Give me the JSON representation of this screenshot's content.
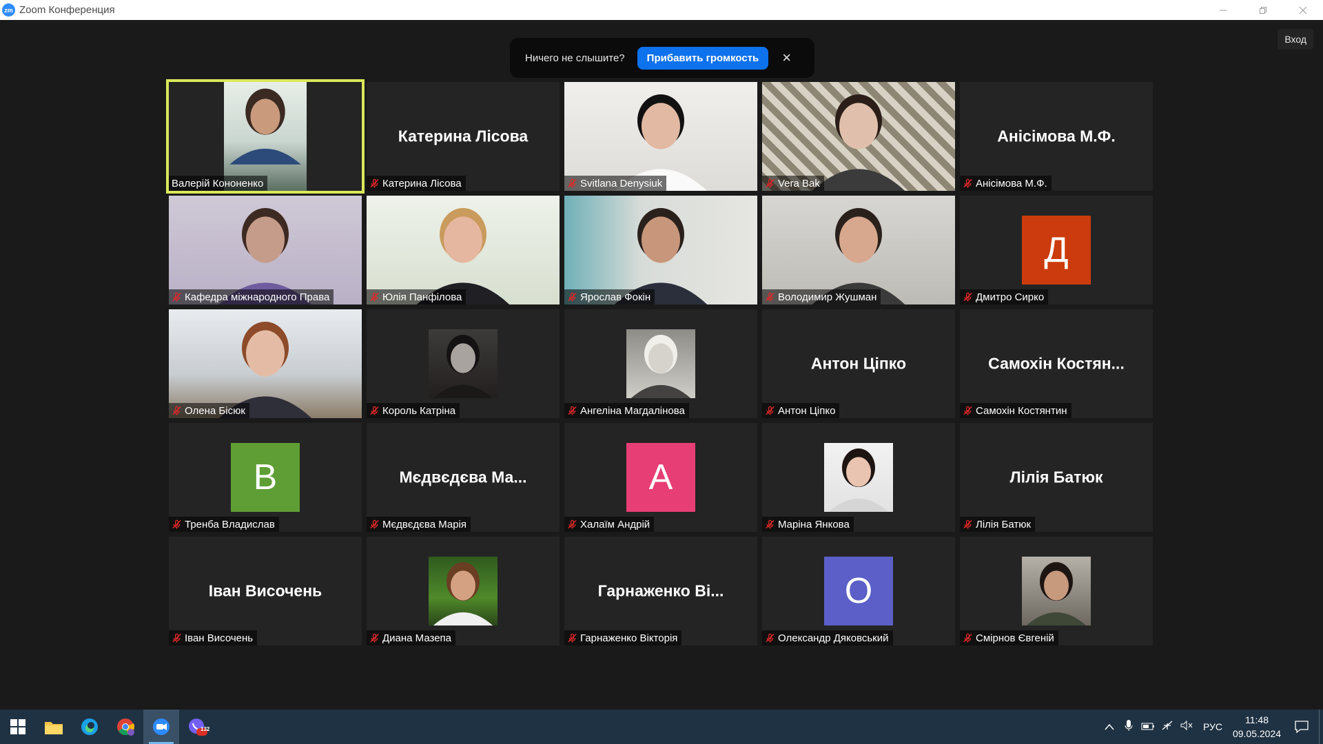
{
  "window": {
    "title": "Zoom Конференция",
    "logo": "zm",
    "sign_in": "Вход"
  },
  "banner": {
    "text": "Ничего не слышите?",
    "button": "Прибавить громкость",
    "close": "×"
  },
  "participants": [
    {
      "name": "Валерій Кононенко",
      "kind": "photo",
      "active": true,
      "muted": false,
      "scene": "man-office"
    },
    {
      "name": "Катерина Лісова",
      "kind": "name",
      "center": "Катерина Лісова",
      "muted": true
    },
    {
      "name": "Svitlana Denysiuk",
      "kind": "photo",
      "muted": true,
      "scene": "woman-dark"
    },
    {
      "name": "Vera Bak",
      "kind": "photo",
      "muted": true,
      "scene": "woman-pattern"
    },
    {
      "name": "Анісімова М.Ф.",
      "kind": "name",
      "center": "Анісімова М.Ф.",
      "muted": true
    },
    {
      "name": "Кафедра міжнародного Права",
      "kind": "photo",
      "muted": true,
      "scene": "woman-glasses"
    },
    {
      "name": "Юлія Панфілова",
      "kind": "photo",
      "muted": true,
      "scene": "woman-blonde"
    },
    {
      "name": "Ярослав Фокін",
      "kind": "photo",
      "muted": true,
      "scene": "man-suit"
    },
    {
      "name": "Володимир Жушман",
      "kind": "photo",
      "muted": true,
      "scene": "man-wall"
    },
    {
      "name": "Дмитро Сирко",
      "kind": "avatar",
      "letter": "Д",
      "color": "#cc3b0d",
      "muted": true
    },
    {
      "name": "Олена Бісюк",
      "kind": "photo",
      "muted": true,
      "scene": "woman-office"
    },
    {
      "name": "Король Катріна",
      "kind": "small-photo",
      "muted": true,
      "scene": "bw-woman-dark"
    },
    {
      "name": "Ангеліна Магдалінова",
      "kind": "small-photo",
      "muted": true,
      "scene": "bw-woman-light"
    },
    {
      "name": "Антон Ціпко",
      "kind": "name",
      "center": "Антон Ціпко",
      "muted": true
    },
    {
      "name": "Самохін Костянтин",
      "kind": "name",
      "center": "Самохін Костян...",
      "muted": true
    },
    {
      "name": "Тренба Владислав",
      "kind": "avatar",
      "letter": "В",
      "color": "#5f9e34",
      "muted": true
    },
    {
      "name": "Мєдвєдєва Марія",
      "kind": "name",
      "center": "Мєдвєдєва Ма...",
      "muted": true
    },
    {
      "name": "Халаїм Андрій",
      "kind": "avatar",
      "letter": "А",
      "color": "#e83e76",
      "muted": true
    },
    {
      "name": "Маріна Янкова",
      "kind": "small-photo",
      "muted": true,
      "scene": "woman-portrait"
    },
    {
      "name": "Лілія Батюк",
      "kind": "name",
      "center": "Лілія Батюк",
      "muted": true
    },
    {
      "name": "Іван Височень",
      "kind": "name",
      "center": "Іван Височень",
      "muted": true
    },
    {
      "name": "Диана Мазепа",
      "kind": "small-photo",
      "muted": true,
      "scene": "woman-garden"
    },
    {
      "name": "Гарнаженко Вікторія",
      "kind": "name",
      "center": "Гарнаженко Ві...",
      "muted": true
    },
    {
      "name": "Олександр Дяковський",
      "kind": "avatar",
      "letter": "О",
      "color": "#5b5fc7",
      "muted": true
    },
    {
      "name": "Смірнов Євгеній",
      "kind": "small-photo",
      "muted": true,
      "scene": "man-car"
    }
  ],
  "taskbar": {
    "apps": [
      "start-icon",
      "file-explorer-icon",
      "edge-icon",
      "chrome-icon",
      "zoom-icon",
      "viber-icon"
    ],
    "viber_badge": "132",
    "language": "РУС",
    "time": "11:48",
    "date": "09.05.2024"
  }
}
